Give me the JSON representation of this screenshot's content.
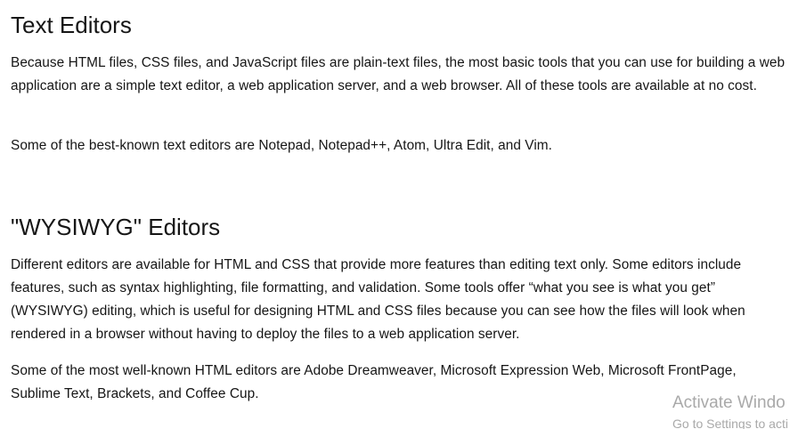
{
  "sections": [
    {
      "title": "Text Editors",
      "paragraphs": [
        "Because HTML files, CSS files, and JavaScript files are plain-text files, the most basic tools that you can use for building a web application are a simple text editor, a web application server, and a web browser. All of these tools are available at no cost.",
        "Some of the best-known text editors are Notepad, Notepad++, Atom, Ultra Edit, and Vim."
      ]
    },
    {
      "title": "\"WYSIWYG\" Editors",
      "paragraphs": [
        "Different editors are available for HTML and CSS that provide more features than editing text only. Some editors include features, such as syntax highlighting, file formatting, and validation. Some tools offer “what you see is what you get” (WYSIWYG) editing, which is useful for designing HTML and CSS files because you can see how the files will look when rendered in a browser without having to deploy the files to a web application server.",
        "Some of the most well-known HTML editors are Adobe Dreamweaver, Microsoft Expression Web, Microsoft FrontPage, Sublime Text, Brackets, and Coffee Cup."
      ]
    }
  ],
  "watermark": {
    "title": "Activate Windo",
    "subtitle": "Go to Settings to acti"
  }
}
